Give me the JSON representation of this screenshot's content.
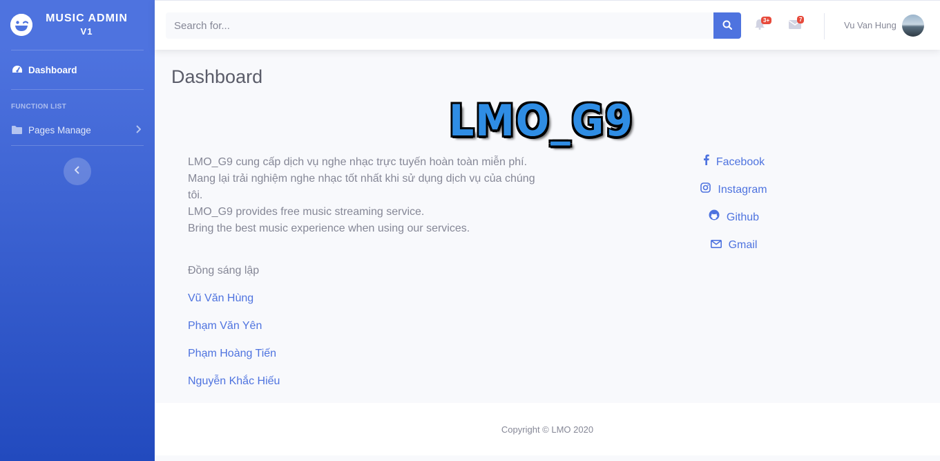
{
  "brand": {
    "title": "MUSIC ADMIN",
    "version": "V1"
  },
  "sidebar": {
    "dashboard_label": "Dashboard",
    "heading": "FUNCTION LIST",
    "pages_label": "Pages Manage"
  },
  "topbar": {
    "search_placeholder": "Search for...",
    "alerts_badge": "3+",
    "messages_badge": "7",
    "user_name": "Vu Van Hung"
  },
  "main": {
    "title": "Dashboard",
    "logo_text": "LMO_G9",
    "about": [
      "LMO_G9 cung cấp dịch vụ nghe nhạc trực tuyến hoàn toàn miễn phí.",
      "Mang lại trải nghiệm nghe nhạc tốt nhất khi sử dụng dịch vụ của chúng tôi.",
      "LMO_G9 provides free music streaming service.",
      "Bring the best music experience when using our services."
    ],
    "founders_heading": "Đồng sáng lập",
    "founders": [
      "Vũ Văn Hùng",
      "Phạm Văn Yên",
      "Phạm Hoàng Tiến",
      "Nguyễn Khắc Hiếu"
    ],
    "social": [
      {
        "label": "Facebook",
        "icon": "facebook-icon"
      },
      {
        "label": "Instagram",
        "icon": "instagram-icon"
      },
      {
        "label": "Github",
        "icon": "github-icon"
      },
      {
        "label": "Gmail",
        "icon": "envelope-icon"
      }
    ]
  },
  "footer": {
    "copyright": "Copyright © LMO 2020"
  },
  "colors": {
    "primary": "#4e73df",
    "sidebar_end": "#224abe",
    "danger": "#e74a3b",
    "text": "#858796"
  }
}
